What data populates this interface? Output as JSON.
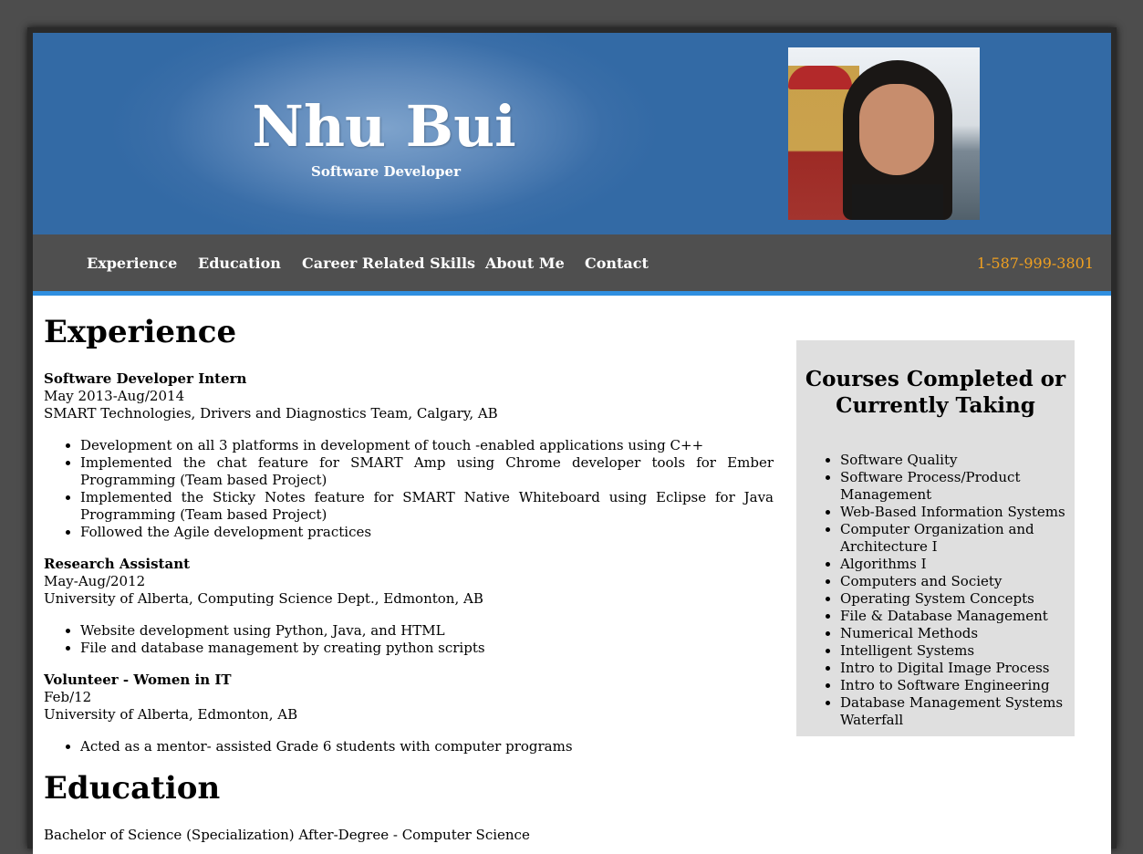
{
  "header": {
    "name": "Nhu Bui",
    "tagline": "Software Developer"
  },
  "nav": {
    "items": [
      {
        "label": "Experience"
      },
      {
        "label": "Education"
      },
      {
        "label": "Career Related Skills"
      },
      {
        "label": "About Me"
      },
      {
        "label": "Contact"
      }
    ],
    "phone": "1-587-999-3801"
  },
  "experience": {
    "heading": "Experience",
    "jobs": [
      {
        "title": "Software Developer Intern",
        "dates": "May 2013-Aug/2014",
        "org": "SMART Technologies, Drivers and Diagnostics Team, Calgary, AB",
        "bullets": [
          "Development on all 3 platforms in development of touch -enabled applications using C++",
          "Implemented the chat feature for SMART Amp using Chrome developer tools for Ember Programming (Team based Project)",
          "Implemented the Sticky Notes feature for SMART Native Whiteboard using Eclipse for Java Programming (Team based Project)",
          "Followed the Agile development practices"
        ]
      },
      {
        "title": "Research Assistant",
        "dates": "May-Aug/2012",
        "org": "University of Alberta, Computing Science Dept., Edmonton, AB",
        "bullets": [
          "Website development using Python, Java, and HTML",
          "File and database management by creating python scripts"
        ]
      },
      {
        "title": "Volunteer - Women in IT",
        "dates": "Feb/12",
        "org": "University of Alberta, Edmonton, AB",
        "bullets": [
          "Acted as a mentor- assisted Grade 6 students with computer programs"
        ]
      }
    ]
  },
  "education": {
    "heading": "Education",
    "degree": "Bachelor of Science (Specialization) After-Degree - Computer Science"
  },
  "sidebar": {
    "heading": "Courses Completed or Currently Taking",
    "courses": [
      "Software Quality",
      "Software Process/Product Management",
      "Web-Based Information Systems",
      "Computer Organization and Architecture I",
      "Algorithms I",
      "Computers and Society",
      "Operating System Concepts",
      "File & Database Management",
      "Numerical Methods",
      "Intelligent Systems",
      "Intro to Digital Image Process",
      "Intro to Software Engineering",
      "Database Management Systems Waterfall"
    ]
  },
  "colors": {
    "header_blue": "#336aa5",
    "nav_gray": "#4f4f4f",
    "accent_blue": "#2f8fe0",
    "phone_orange": "#f0a020",
    "sidebar_gray": "#dfdfdf"
  }
}
